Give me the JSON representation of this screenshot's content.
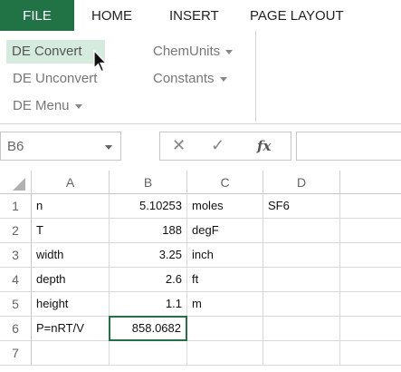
{
  "tabs": [
    {
      "label": "FILE"
    },
    {
      "label": "HOME"
    },
    {
      "label": "INSERT"
    },
    {
      "label": "PAGE LAYOUT"
    }
  ],
  "ribbon": {
    "de_convert": "DE Convert",
    "de_unconvert": "DE Unconvert",
    "de_menu": "DE Menu",
    "chemunits": "ChemUnits",
    "constants": "Constants"
  },
  "formula_bar": {
    "name_box": "B6",
    "cancel_icon": "✕",
    "enter_icon": "✓",
    "fx_label": "fx",
    "formula": ""
  },
  "colors": {
    "accent": "#217346",
    "highlight": "#d5ebdd"
  },
  "grid": {
    "columns": [
      "A",
      "B",
      "C",
      "D"
    ],
    "rows": [
      {
        "num": "1",
        "A": "n",
        "B": "5.10253",
        "C": "moles",
        "D": "SF6"
      },
      {
        "num": "2",
        "A": "T",
        "B": "188",
        "C": "degF",
        "D": ""
      },
      {
        "num": "3",
        "A": "width",
        "B": "3.25",
        "C": "inch",
        "D": ""
      },
      {
        "num": "4",
        "A": "depth",
        "B": "2.6",
        "C": "ft",
        "D": ""
      },
      {
        "num": "5",
        "A": "height",
        "B": "1.1",
        "C": "m",
        "D": ""
      },
      {
        "num": "6",
        "A": "P=nRT/V",
        "B": "858.0682",
        "C": "",
        "D": ""
      },
      {
        "num": "7",
        "A": "",
        "B": "",
        "C": "",
        "D": ""
      }
    ],
    "selected_cell": "B6"
  }
}
